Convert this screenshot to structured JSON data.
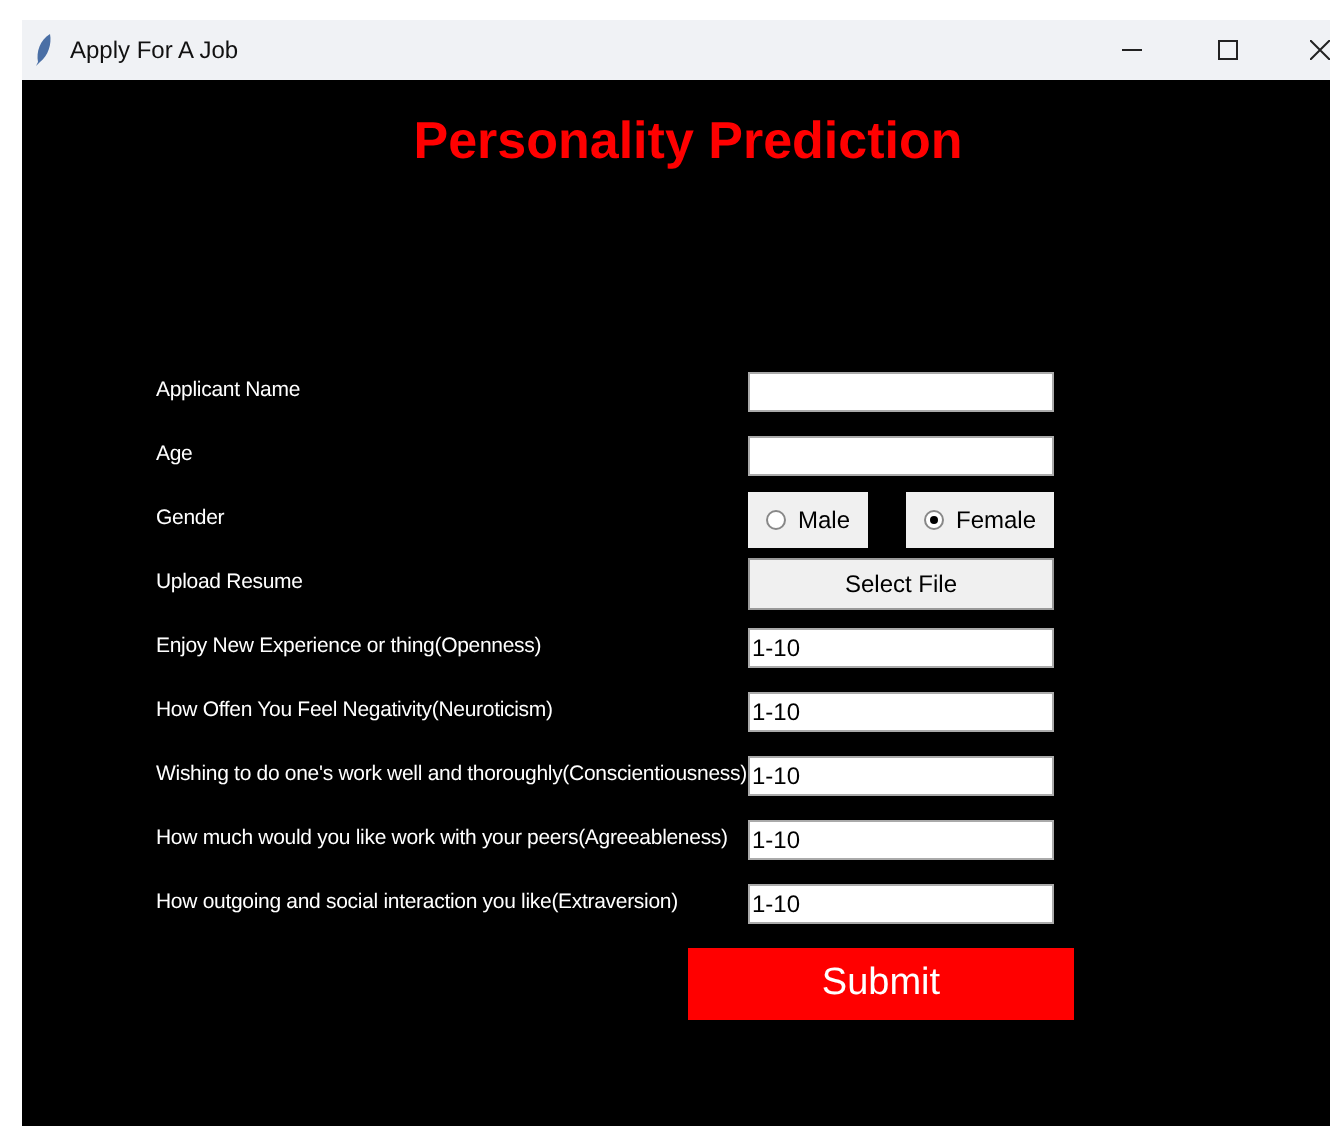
{
  "window": {
    "title": "Apply For A Job"
  },
  "heading": "Personality Prediction",
  "fields": [
    {
      "kind": "text",
      "label": "Applicant Name"
    },
    {
      "kind": "text",
      "label": "Age"
    },
    {
      "kind": "radio",
      "label": "Gender",
      "options": [
        {
          "label": "Male",
          "selected": false
        },
        {
          "label": "Female",
          "selected": true
        }
      ]
    },
    {
      "kind": "file",
      "label": "Upload Resume",
      "button": "Select File"
    },
    {
      "kind": "text",
      "label": "Enjoy New Experience or thing(Openness)",
      "value": "1-10"
    },
    {
      "kind": "text",
      "label": "How Offen You Feel Negativity(Neuroticism)",
      "value": "1-10"
    },
    {
      "kind": "text",
      "label": "Wishing to do one's work well and thoroughly(Conscientiousness)",
      "value": "1-10"
    },
    {
      "kind": "text",
      "label": "How much would you like work with your peers(Agreeableness)",
      "value": "1-10"
    },
    {
      "kind": "text",
      "label": "How outgoing and social interaction you like(Extraversion)",
      "value": "1-10"
    }
  ],
  "submit": "Submit"
}
